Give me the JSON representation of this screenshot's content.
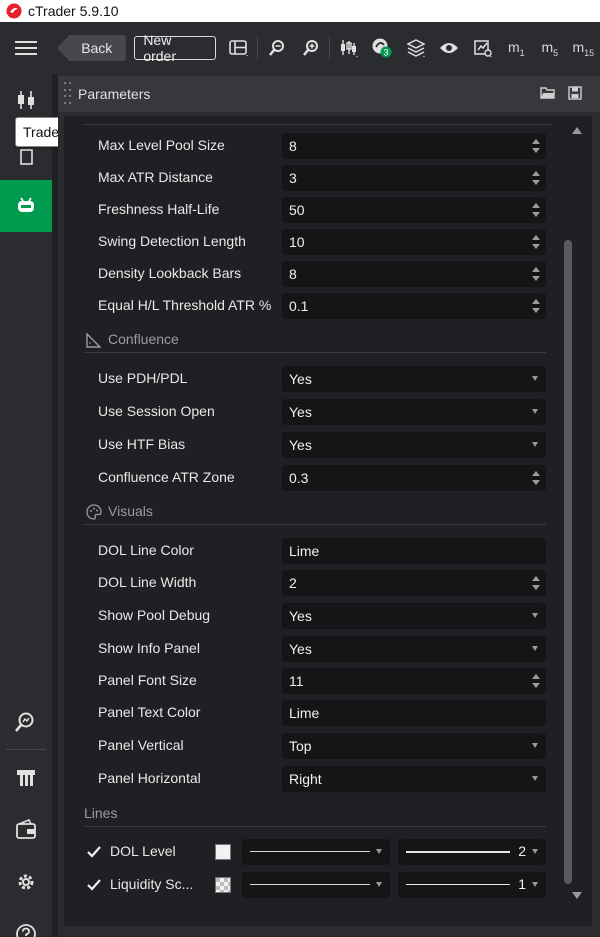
{
  "app": {
    "title": "cTrader 5.9.10",
    "brand_color": "#e8202a",
    "accent": "#009b4f"
  },
  "toolbar": {
    "back_label": "Back",
    "new_order_label": "New order",
    "badge_count": "3",
    "timeframes": [
      {
        "main": "m",
        "sub": "1"
      },
      {
        "main": "m",
        "sub": "5"
      },
      {
        "main": "m",
        "sub": "15"
      }
    ]
  },
  "sidebar": {
    "tooltip": "Trade"
  },
  "panel": {
    "title": "Parameters",
    "fields_top": [
      {
        "label": "Max Level Pool Size",
        "value": "8",
        "kind": "number"
      },
      {
        "label": "Max ATR Distance",
        "value": "3",
        "kind": "number"
      },
      {
        "label": "Freshness Half-Life",
        "value": "50",
        "kind": "number"
      },
      {
        "label": "Swing Detection Length",
        "value": "10",
        "kind": "number"
      },
      {
        "label": "Density Lookback Bars",
        "value": "8",
        "kind": "number"
      },
      {
        "label": "Equal H/L Threshold ATR %",
        "value": "0.1",
        "kind": "number"
      }
    ],
    "confluence": {
      "title": "Confluence",
      "fields": [
        {
          "label": "Use PDH/PDL",
          "value": "Yes",
          "kind": "select"
        },
        {
          "label": "Use Session Open",
          "value": "Yes",
          "kind": "select"
        },
        {
          "label": "Use HTF Bias",
          "value": "Yes",
          "kind": "select"
        },
        {
          "label": "Confluence ATR Zone",
          "value": "0.3",
          "kind": "number"
        }
      ]
    },
    "visuals": {
      "title": "Visuals",
      "fields": [
        {
          "label": "DOL Line Color",
          "value": "Lime",
          "kind": "text"
        },
        {
          "label": "DOL Line Width",
          "value": "2",
          "kind": "number"
        },
        {
          "label": "Show Pool Debug",
          "value": "Yes",
          "kind": "select"
        },
        {
          "label": "Show Info Panel",
          "value": "Yes",
          "kind": "select"
        },
        {
          "label": "Panel Font Size",
          "value": "11",
          "kind": "number"
        },
        {
          "label": "Panel Text Color",
          "value": "Lime",
          "kind": "text"
        },
        {
          "label": "Panel Vertical",
          "value": "Top",
          "kind": "select"
        },
        {
          "label": "Panel Horizontal",
          "value": "Right",
          "kind": "select"
        }
      ]
    },
    "lines": {
      "title": "Lines",
      "items": [
        {
          "label": "DOL Level",
          "width": "2"
        },
        {
          "label": "Liquidity Sc...",
          "width": "1"
        }
      ]
    }
  }
}
